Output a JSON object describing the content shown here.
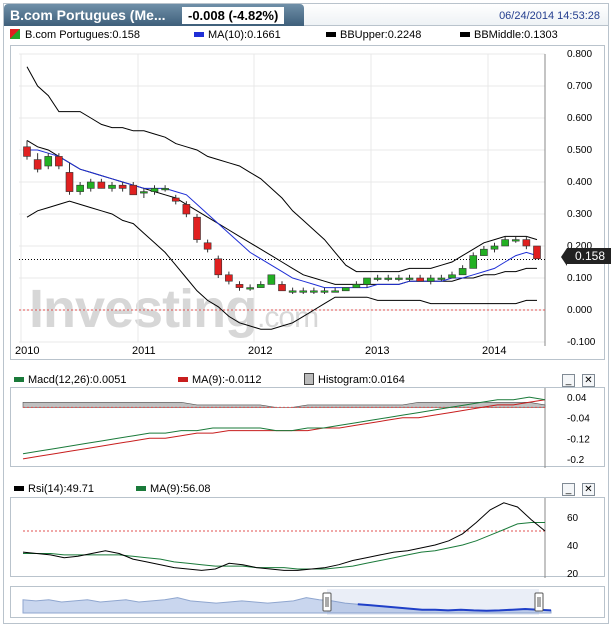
{
  "header": {
    "title": "B.com Portugues (Me...",
    "change": "-0.008 (-4.82%)",
    "timestamp": "06/24/2014 14:53:28"
  },
  "main_legend": {
    "symbol": "B.com Portugues:0.158",
    "ma": "MA(10):0.1661",
    "bb_upper": "BBUpper:0.2248",
    "bb_middle": "BBMiddle:0.1303"
  },
  "price_tag": "0.158",
  "watermark": {
    "brand": "Investing",
    "suffix": ".com"
  },
  "colors": {
    "up": "#22b022",
    "down": "#e02020",
    "ma": "#1f2fd6",
    "bb": "#000000",
    "macd": "#1a7a3a",
    "signal": "#c81e1e",
    "histogram": "#c0c0c0",
    "rsi": "#000000",
    "rsi_ma": "#1a7a3a"
  },
  "chart_data": [
    {
      "type": "candlestick",
      "title": "B.com Portugues",
      "x_ticks": [
        "2010",
        "2011",
        "2012",
        "2013",
        "2014"
      ],
      "y_ticks": [
        "0.800",
        "0.700",
        "0.600",
        "0.500",
        "0.400",
        "0.300",
        "0.200",
        "0.100",
        "0.000",
        "-0.100"
      ],
      "ylim": [
        -0.1,
        0.8
      ],
      "last_price": 0.158,
      "candles": [
        [
          0.51,
          0.53,
          0.47,
          0.48
        ],
        [
          0.47,
          0.49,
          0.43,
          0.44
        ],
        [
          0.45,
          0.49,
          0.44,
          0.48
        ],
        [
          0.48,
          0.49,
          0.44,
          0.45
        ],
        [
          0.43,
          0.46,
          0.36,
          0.37
        ],
        [
          0.37,
          0.4,
          0.36,
          0.39
        ],
        [
          0.38,
          0.41,
          0.37,
          0.4
        ],
        [
          0.4,
          0.41,
          0.38,
          0.38
        ],
        [
          0.38,
          0.4,
          0.37,
          0.39
        ],
        [
          0.39,
          0.4,
          0.37,
          0.38
        ],
        [
          0.39,
          0.4,
          0.36,
          0.36
        ],
        [
          0.37,
          0.38,
          0.35,
          0.37
        ],
        [
          0.37,
          0.39,
          0.36,
          0.38
        ],
        [
          0.38,
          0.39,
          0.37,
          0.38
        ],
        [
          0.35,
          0.36,
          0.33,
          0.34
        ],
        [
          0.33,
          0.34,
          0.29,
          0.3
        ],
        [
          0.29,
          0.3,
          0.21,
          0.22
        ],
        [
          0.21,
          0.22,
          0.18,
          0.19
        ],
        [
          0.16,
          0.17,
          0.1,
          0.11
        ],
        [
          0.11,
          0.12,
          0.08,
          0.09
        ],
        [
          0.08,
          0.09,
          0.06,
          0.07
        ],
        [
          0.07,
          0.08,
          0.06,
          0.07
        ],
        [
          0.07,
          0.09,
          0.07,
          0.08
        ],
        [
          0.08,
          0.11,
          0.08,
          0.11
        ],
        [
          0.08,
          0.09,
          0.06,
          0.06
        ],
        [
          0.06,
          0.07,
          0.05,
          0.06
        ],
        [
          0.06,
          0.07,
          0.05,
          0.06
        ],
        [
          0.06,
          0.07,
          0.05,
          0.06
        ],
        [
          0.06,
          0.07,
          0.05,
          0.06
        ],
        [
          0.06,
          0.07,
          0.06,
          0.06
        ],
        [
          0.06,
          0.07,
          0.06,
          0.07
        ],
        [
          0.07,
          0.09,
          0.07,
          0.08
        ],
        [
          0.08,
          0.1,
          0.07,
          0.1
        ],
        [
          0.1,
          0.11,
          0.09,
          0.1
        ],
        [
          0.1,
          0.11,
          0.09,
          0.1
        ],
        [
          0.1,
          0.11,
          0.09,
          0.1
        ],
        [
          0.1,
          0.11,
          0.09,
          0.1
        ],
        [
          0.1,
          0.11,
          0.09,
          0.09
        ],
        [
          0.09,
          0.11,
          0.08,
          0.1
        ],
        [
          0.1,
          0.11,
          0.09,
          0.1
        ],
        [
          0.1,
          0.12,
          0.1,
          0.11
        ],
        [
          0.11,
          0.14,
          0.11,
          0.13
        ],
        [
          0.13,
          0.18,
          0.13,
          0.17
        ],
        [
          0.17,
          0.2,
          0.17,
          0.19
        ],
        [
          0.19,
          0.21,
          0.18,
          0.2
        ],
        [
          0.2,
          0.23,
          0.2,
          0.22
        ],
        [
          0.22,
          0.23,
          0.21,
          0.22
        ],
        [
          0.22,
          0.23,
          0.19,
          0.2
        ],
        [
          0.2,
          0.2,
          0.16,
          0.16
        ]
      ],
      "ma10": [
        0.5,
        0.5,
        0.49,
        0.48,
        0.46,
        0.44,
        0.43,
        0.42,
        0.41,
        0.4,
        0.39,
        0.38,
        0.38,
        0.38,
        0.37,
        0.36,
        0.33,
        0.3,
        0.27,
        0.24,
        0.21,
        0.18,
        0.16,
        0.14,
        0.12,
        0.1,
        0.09,
        0.08,
        0.07,
        0.07,
        0.07,
        0.07,
        0.07,
        0.08,
        0.08,
        0.08,
        0.09,
        0.09,
        0.09,
        0.09,
        0.1,
        0.1,
        0.11,
        0.12,
        0.13,
        0.15,
        0.17,
        0.18,
        0.17
      ],
      "bb_upper": [
        0.76,
        0.7,
        0.67,
        0.62,
        0.62,
        0.62,
        0.6,
        0.58,
        0.57,
        0.57,
        0.56,
        0.56,
        0.55,
        0.54,
        0.52,
        0.51,
        0.5,
        0.48,
        0.47,
        0.46,
        0.45,
        0.43,
        0.41,
        0.38,
        0.35,
        0.31,
        0.28,
        0.25,
        0.22,
        0.18,
        0.14,
        0.12,
        0.12,
        0.12,
        0.12,
        0.12,
        0.13,
        0.13,
        0.13,
        0.14,
        0.15,
        0.17,
        0.19,
        0.21,
        0.22,
        0.23,
        0.23,
        0.23,
        0.22
      ],
      "bb_middle": [
        0.53,
        0.51,
        0.5,
        0.48,
        0.46,
        0.44,
        0.43,
        0.42,
        0.41,
        0.4,
        0.39,
        0.38,
        0.37,
        0.36,
        0.35,
        0.33,
        0.31,
        0.29,
        0.27,
        0.25,
        0.23,
        0.21,
        0.19,
        0.17,
        0.15,
        0.13,
        0.11,
        0.1,
        0.09,
        0.08,
        0.08,
        0.08,
        0.08,
        0.08,
        0.08,
        0.08,
        0.09,
        0.09,
        0.09,
        0.09,
        0.09,
        0.1,
        0.1,
        0.11,
        0.11,
        0.12,
        0.12,
        0.13,
        0.13
      ],
      "bb_lower": [
        0.29,
        0.31,
        0.32,
        0.33,
        0.34,
        0.33,
        0.32,
        0.31,
        0.3,
        0.28,
        0.27,
        0.24,
        0.21,
        0.18,
        0.14,
        0.1,
        0.06,
        0.03,
        0.01,
        -0.02,
        -0.04,
        -0.05,
        -0.06,
        -0.06,
        -0.05,
        -0.04,
        -0.02,
        0.0,
        0.02,
        0.04,
        0.04,
        0.04,
        0.04,
        0.03,
        0.03,
        0.03,
        0.03,
        0.03,
        0.02,
        0.02,
        0.02,
        0.02,
        0.02,
        0.02,
        0.02,
        0.02,
        0.02,
        0.03,
        0.03
      ]
    },
    {
      "type": "line",
      "title": "Macd(12,26)",
      "legend": [
        "Macd(12,26):0.0051",
        "MA(9):-0.0112",
        "Histogram:0.0164"
      ],
      "y_ticks": [
        "0.04",
        "-0.04",
        "-0.12",
        "-0.2"
      ],
      "ylim": [
        -0.22,
        0.06
      ],
      "macd": [
        -0.18,
        -0.17,
        -0.16,
        -0.15,
        -0.14,
        -0.13,
        -0.12,
        -0.11,
        -0.1,
        -0.1,
        -0.09,
        -0.09,
        -0.08,
        -0.08,
        -0.08,
        -0.08,
        -0.09,
        -0.09,
        -0.08,
        -0.08,
        -0.07,
        -0.06,
        -0.05,
        -0.04,
        -0.03,
        -0.02,
        -0.01,
        0.0,
        0.01,
        0.02,
        0.03,
        0.03,
        0.04,
        0.03
      ],
      "signal": [
        -0.2,
        -0.19,
        -0.18,
        -0.17,
        -0.16,
        -0.15,
        -0.14,
        -0.13,
        -0.12,
        -0.12,
        -0.11,
        -0.1,
        -0.1,
        -0.09,
        -0.09,
        -0.09,
        -0.09,
        -0.09,
        -0.09,
        -0.08,
        -0.08,
        -0.07,
        -0.06,
        -0.05,
        -0.04,
        -0.04,
        -0.03,
        -0.02,
        -0.01,
        0.0,
        0.01,
        0.01,
        0.02,
        0.03
      ],
      "histogram": [
        0.02,
        0.02,
        0.02,
        0.02,
        0.02,
        0.02,
        0.02,
        0.02,
        0.02,
        0.02,
        0.02,
        0.01,
        0.01,
        0.01,
        0.01,
        0.01,
        0.0,
        0.0,
        0.01,
        0.01,
        0.01,
        0.01,
        0.01,
        0.01,
        0.01,
        0.02,
        0.02,
        0.02,
        0.02,
        0.02,
        0.02,
        0.02,
        0.02,
        0.01
      ]
    },
    {
      "type": "line",
      "title": "Rsi(14)",
      "legend": [
        "Rsi(14):49.71",
        "MA(9):56.08"
      ],
      "y_ticks": [
        "60",
        "40",
        "20"
      ],
      "ylim": [
        18,
        72
      ],
      "overbought_line": 50,
      "rsi": [
        35,
        34,
        33,
        31,
        32,
        34,
        36,
        34,
        30,
        28,
        26,
        24,
        23,
        22,
        23,
        27,
        26,
        24,
        23,
        22,
        22,
        23,
        24,
        26,
        29,
        31,
        33,
        35,
        36,
        38,
        40,
        43,
        48,
        56,
        65,
        70,
        67,
        58,
        50
      ],
      "rsi_ma": [
        34,
        34,
        34,
        33,
        33,
        33,
        33,
        33,
        32,
        31,
        30,
        28,
        27,
        26,
        25,
        25,
        25,
        24,
        24,
        24,
        23,
        23,
        23,
        24,
        25,
        27,
        29,
        31,
        33,
        35,
        36,
        38,
        40,
        43,
        47,
        51,
        55,
        56,
        56
      ]
    }
  ],
  "navigator": {
    "handles": [
      "left",
      "right"
    ]
  }
}
